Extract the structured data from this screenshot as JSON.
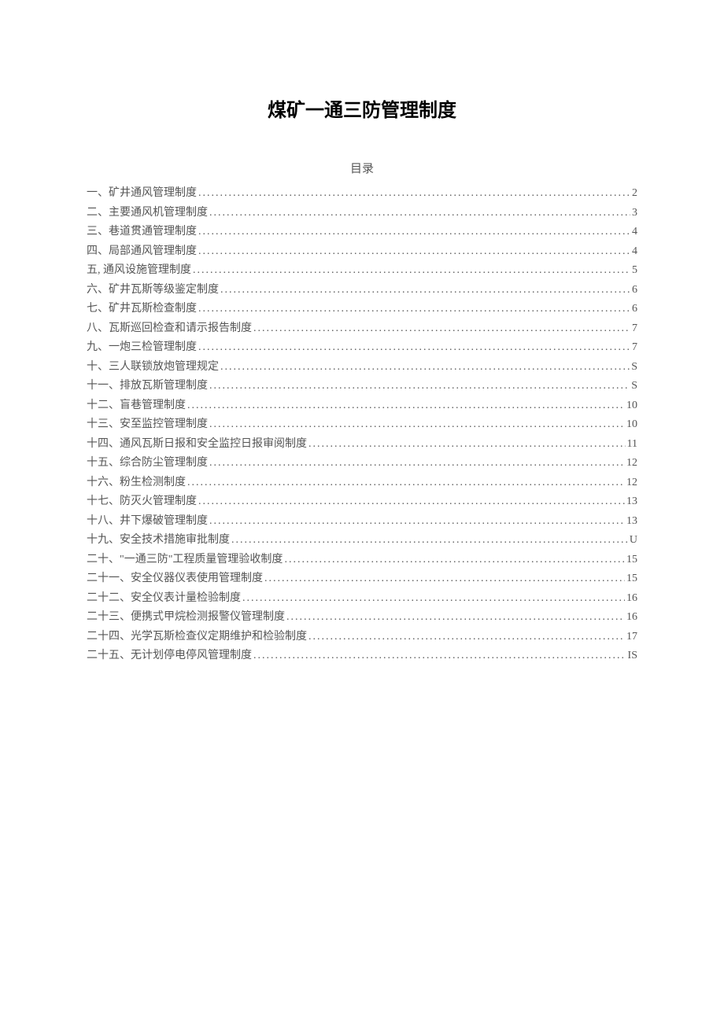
{
  "title": "煤矿一通三防管理制度",
  "toc_label": "目录",
  "toc": [
    {
      "text": "一、矿井通风管理制度",
      "page": "2"
    },
    {
      "text": "二、主要通风机管理制度",
      "page": "3"
    },
    {
      "text": "三、巷道贯通管理制度",
      "page": "4"
    },
    {
      "text": "四、局部通风管理制度",
      "page": "4"
    },
    {
      "text": "五, 通风设施管理制度",
      "page": "5"
    },
    {
      "text": "六、矿井瓦斯等级鉴定制度",
      "page": "6"
    },
    {
      "text": "七、矿井瓦斯检查制度",
      "page": "6"
    },
    {
      "text": "八、瓦斯巡回检查和请示报告制度",
      "page": "7"
    },
    {
      "text": "九、一炮三检管理制度",
      "page": "7"
    },
    {
      "text": "十、三人联锁放炮管理规定",
      "page": "S"
    },
    {
      "text": "十一、排放瓦斯管理制度",
      "page": "S"
    },
    {
      "text": "十二、盲巷管理制度",
      "page": "10"
    },
    {
      "text": "十三、安至监控管理制度",
      "page": "10"
    },
    {
      "text": "十四、通风瓦斯日报和安全监控日报审阅制度",
      "page": "11"
    },
    {
      "text": "十五、综合防尘管理制度",
      "page": "12"
    },
    {
      "text": "十六、粉生检测制度",
      "page": "12"
    },
    {
      "text": "十七、防灭火管理制度",
      "page": "13"
    },
    {
      "text": "十八、井下爆破管理制度",
      "page": "13"
    },
    {
      "text": "十九、安全技术措施审批制度 ",
      "page": "U"
    },
    {
      "text": "二十、\"一通三防\"工程质量管理验收制度",
      "page": "15"
    },
    {
      "text": "二十一、安全仪器仪表使用管理制度",
      "page": "15"
    },
    {
      "text": "二十二、安全仪表计量检验制度",
      "page": "16"
    },
    {
      "text": "二十三、便携式甲烷检测报警仪管理制度",
      "page": "16"
    },
    {
      "text": "二十四、光学瓦斯检查仪定期维护和检验制度",
      "page": "17"
    },
    {
      "text": "二十五、无计划停电停风管理制度",
      "page": "IS"
    }
  ]
}
